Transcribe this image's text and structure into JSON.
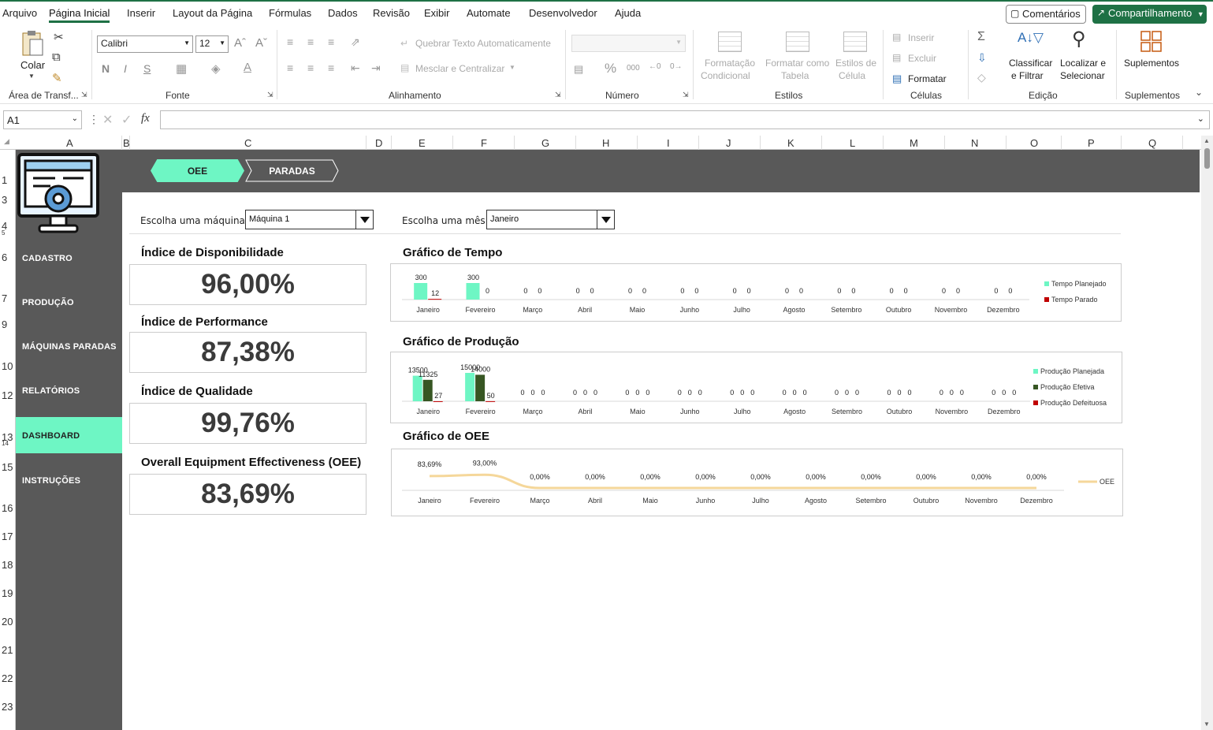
{
  "menu": {
    "tabs": [
      "Arquivo",
      "Página Inicial",
      "Inserir",
      "Layout da Página",
      "Fórmulas",
      "Dados",
      "Revisão",
      "Exibir",
      "Automate",
      "Desenvolvedor",
      "Ajuda"
    ],
    "comments_label": "Comentários",
    "share_label": "Compartilhamento"
  },
  "ribbon": {
    "paste_label": "Colar",
    "clipboard_group": "Área de Transf...",
    "font_name": "Calibri",
    "font_size": "12",
    "bold": "N",
    "italic": "I",
    "underline": "S",
    "font_group": "Fonte",
    "wrap_text": "Quebrar Texto Automaticamente",
    "merge_center": "Mesclar e Centralizar",
    "alignment_group": "Alinhamento",
    "number_group": "Número",
    "cond_format_1": "Formatação",
    "cond_format_2": "Condicional",
    "format_table_1": "Formatar como",
    "format_table_2": "Tabela",
    "cell_styles_1": "Estilos de",
    "cell_styles_2": "Célula",
    "styles_group": "Estilos",
    "insert_label": "Inserir",
    "delete_label": "Excluir",
    "format_label": "Formatar",
    "cells_group": "Células",
    "sort_filter_1": "Classificar",
    "sort_filter_2": "e Filtrar",
    "find_select_1": "Localizar e",
    "find_select_2": "Selecionar",
    "editing_group": "Edição",
    "addins_label": "Suplementos",
    "addins_group": "Suplementos"
  },
  "formula_bar": {
    "name_box": "A1",
    "fx": "fx",
    "formula": ""
  },
  "columns": [
    "A",
    "B",
    "C",
    "D",
    "E",
    "F",
    "G",
    "H",
    "I",
    "J",
    "K",
    "L",
    "M",
    "N",
    "O",
    "P",
    "Q"
  ],
  "rows": [
    "1",
    "3",
    "4",
    "5",
    "6",
    "7",
    "9",
    "10",
    "12",
    "13",
    "14",
    "15",
    "16",
    "17",
    "18",
    "19",
    "20",
    "21",
    "22",
    "23"
  ],
  "tabs_top": {
    "oee": "OEE",
    "paradas": "PARADAS"
  },
  "sidebar": {
    "items": [
      "CADASTRO",
      "PRODUÇÃO",
      "MÁQUINAS PARADAS",
      "RELATÓRIOS",
      "DASHBOARD",
      "INSTRUÇÕES"
    ],
    "active": "DASHBOARD"
  },
  "filters": {
    "machine_label": "Escolha uma máquina:",
    "machine_value": "Máquina 1",
    "month_label": "Escolha uma mês:",
    "month_value": "Janeiro"
  },
  "kpis": [
    {
      "title": "Índice de Disponibilidade",
      "value": "96,00%"
    },
    {
      "title": "Índice de Performance",
      "value": "87,38%"
    },
    {
      "title": "Índice de Qualidade",
      "value": "99,76%"
    },
    {
      "title": "Overall Equipment Effectiveness (OEE)",
      "value": "83,69%"
    }
  ],
  "chart_data": [
    {
      "type": "bar",
      "title": "Gráfico de Tempo",
      "categories": [
        "Janeiro",
        "Fevereiro",
        "Março",
        "Abril",
        "Maio",
        "Junho",
        "Julho",
        "Agosto",
        "Setembro",
        "Outubro",
        "Novembro",
        "Dezembro"
      ],
      "series": [
        {
          "name": "Tempo Planejado",
          "color": "#6ef6c4",
          "values": [
            300,
            300,
            0,
            0,
            0,
            0,
            0,
            0,
            0,
            0,
            0,
            0
          ]
        },
        {
          "name": "Tempo Parado",
          "color": "#c00000",
          "values": [
            12,
            0,
            0,
            0,
            0,
            0,
            0,
            0,
            0,
            0,
            0,
            0
          ]
        }
      ],
      "legend": "right"
    },
    {
      "type": "bar",
      "title": "Gráfico de Produção",
      "categories": [
        "Janeiro",
        "Fevereiro",
        "Março",
        "Abril",
        "Maio",
        "Junho",
        "Julho",
        "Agosto",
        "Setembro",
        "Outubro",
        "Novembro",
        "Dezembro"
      ],
      "series": [
        {
          "name": "Produção Planejada",
          "color": "#6ef6c4",
          "values": [
            13500,
            15000,
            0,
            0,
            0,
            0,
            0,
            0,
            0,
            0,
            0,
            0
          ]
        },
        {
          "name": "Produção Efetiva",
          "color": "#375623",
          "values": [
            11325,
            14000,
            0,
            0,
            0,
            0,
            0,
            0,
            0,
            0,
            0,
            0
          ]
        },
        {
          "name": "Produção Defeituosa",
          "color": "#c00000",
          "values": [
            27,
            50,
            0,
            0,
            0,
            0,
            0,
            0,
            0,
            0,
            0,
            0
          ]
        }
      ],
      "legend": "right"
    },
    {
      "type": "line",
      "title": "Gráfico de OEE",
      "categories": [
        "Janeiro",
        "Fevereiro",
        "Março",
        "Abril",
        "Maio",
        "Junho",
        "Julho",
        "Agosto",
        "Setembro",
        "Outubro",
        "Novembro",
        "Dezembro"
      ],
      "series": [
        {
          "name": "OEE",
          "color": "#f5d79a",
          "values": [
            83.69,
            93.0,
            0,
            0,
            0,
            0,
            0,
            0,
            0,
            0,
            0,
            0
          ],
          "labels": [
            "83,69%",
            "93,00%",
            "0,00%",
            "0,00%",
            "0,00%",
            "0,00%",
            "0,00%",
            "0,00%",
            "0,00%",
            "0,00%",
            "0,00%",
            "0,00%"
          ]
        }
      ],
      "legend": "right"
    }
  ]
}
